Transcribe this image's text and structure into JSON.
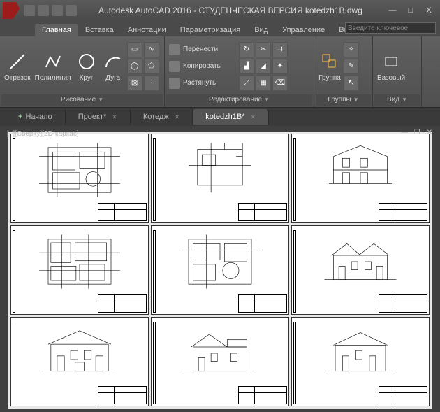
{
  "title": "Autodesk AutoCAD 2016 - СТУДЕНЧЕСКАЯ ВЕРСИЯ    kotedzh1B.dwg",
  "window": {
    "min": "—",
    "max": "□",
    "close": "X"
  },
  "ribbonTabs": [
    "Главная",
    "Вставка",
    "Аннотации",
    "Параметризация",
    "Вид",
    "Управление",
    "Вывод"
  ],
  "search": {
    "placeholder": "Введите ключевое"
  },
  "panels": {
    "draw": {
      "title": "Рисование",
      "line": "Отрезок",
      "polyline": "Полилиния",
      "circle": "Круг",
      "arc": "Дуга"
    },
    "modify": {
      "title": "Редактирование",
      "move": "Перенести",
      "copy": "Копировать",
      "stretch": "Растянуть"
    },
    "groups": {
      "title": "Группы",
      "group": "Группа"
    },
    "view": {
      "title": "Вид",
      "base": "Базовый"
    }
  },
  "docTabs": [
    {
      "label": "Начало",
      "active": false
    },
    {
      "label": "Проект*",
      "active": false
    },
    {
      "label": "Котедж",
      "active": false
    },
    {
      "label": "kotedzh1B*",
      "active": true
    }
  ],
  "viewport": {
    "label": "[–][Сверху][2D-каркас]"
  }
}
